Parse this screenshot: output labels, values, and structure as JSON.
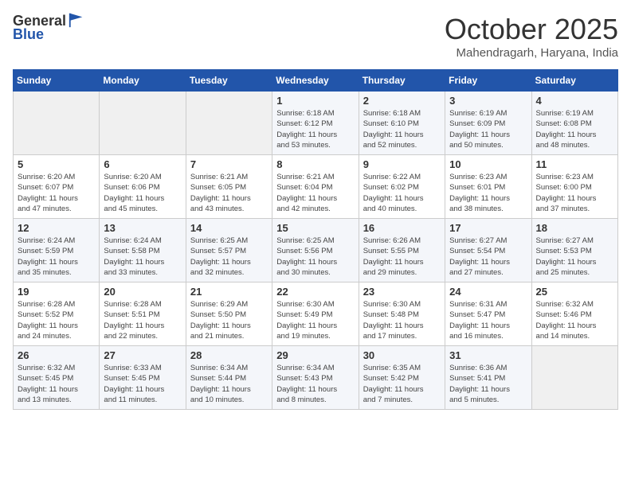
{
  "header": {
    "logo_line1": "General",
    "logo_line2": "Blue",
    "month": "October 2025",
    "location": "Mahendragarh, Haryana, India"
  },
  "weekdays": [
    "Sunday",
    "Monday",
    "Tuesday",
    "Wednesday",
    "Thursday",
    "Friday",
    "Saturday"
  ],
  "weeks": [
    [
      {
        "day": "",
        "info": ""
      },
      {
        "day": "",
        "info": ""
      },
      {
        "day": "",
        "info": ""
      },
      {
        "day": "1",
        "info": "Sunrise: 6:18 AM\nSunset: 6:12 PM\nDaylight: 11 hours\nand 53 minutes."
      },
      {
        "day": "2",
        "info": "Sunrise: 6:18 AM\nSunset: 6:10 PM\nDaylight: 11 hours\nand 52 minutes."
      },
      {
        "day": "3",
        "info": "Sunrise: 6:19 AM\nSunset: 6:09 PM\nDaylight: 11 hours\nand 50 minutes."
      },
      {
        "day": "4",
        "info": "Sunrise: 6:19 AM\nSunset: 6:08 PM\nDaylight: 11 hours\nand 48 minutes."
      }
    ],
    [
      {
        "day": "5",
        "info": "Sunrise: 6:20 AM\nSunset: 6:07 PM\nDaylight: 11 hours\nand 47 minutes."
      },
      {
        "day": "6",
        "info": "Sunrise: 6:20 AM\nSunset: 6:06 PM\nDaylight: 11 hours\nand 45 minutes."
      },
      {
        "day": "7",
        "info": "Sunrise: 6:21 AM\nSunset: 6:05 PM\nDaylight: 11 hours\nand 43 minutes."
      },
      {
        "day": "8",
        "info": "Sunrise: 6:21 AM\nSunset: 6:04 PM\nDaylight: 11 hours\nand 42 minutes."
      },
      {
        "day": "9",
        "info": "Sunrise: 6:22 AM\nSunset: 6:02 PM\nDaylight: 11 hours\nand 40 minutes."
      },
      {
        "day": "10",
        "info": "Sunrise: 6:23 AM\nSunset: 6:01 PM\nDaylight: 11 hours\nand 38 minutes."
      },
      {
        "day": "11",
        "info": "Sunrise: 6:23 AM\nSunset: 6:00 PM\nDaylight: 11 hours\nand 37 minutes."
      }
    ],
    [
      {
        "day": "12",
        "info": "Sunrise: 6:24 AM\nSunset: 5:59 PM\nDaylight: 11 hours\nand 35 minutes."
      },
      {
        "day": "13",
        "info": "Sunrise: 6:24 AM\nSunset: 5:58 PM\nDaylight: 11 hours\nand 33 minutes."
      },
      {
        "day": "14",
        "info": "Sunrise: 6:25 AM\nSunset: 5:57 PM\nDaylight: 11 hours\nand 32 minutes."
      },
      {
        "day": "15",
        "info": "Sunrise: 6:25 AM\nSunset: 5:56 PM\nDaylight: 11 hours\nand 30 minutes."
      },
      {
        "day": "16",
        "info": "Sunrise: 6:26 AM\nSunset: 5:55 PM\nDaylight: 11 hours\nand 29 minutes."
      },
      {
        "day": "17",
        "info": "Sunrise: 6:27 AM\nSunset: 5:54 PM\nDaylight: 11 hours\nand 27 minutes."
      },
      {
        "day": "18",
        "info": "Sunrise: 6:27 AM\nSunset: 5:53 PM\nDaylight: 11 hours\nand 25 minutes."
      }
    ],
    [
      {
        "day": "19",
        "info": "Sunrise: 6:28 AM\nSunset: 5:52 PM\nDaylight: 11 hours\nand 24 minutes."
      },
      {
        "day": "20",
        "info": "Sunrise: 6:28 AM\nSunset: 5:51 PM\nDaylight: 11 hours\nand 22 minutes."
      },
      {
        "day": "21",
        "info": "Sunrise: 6:29 AM\nSunset: 5:50 PM\nDaylight: 11 hours\nand 21 minutes."
      },
      {
        "day": "22",
        "info": "Sunrise: 6:30 AM\nSunset: 5:49 PM\nDaylight: 11 hours\nand 19 minutes."
      },
      {
        "day": "23",
        "info": "Sunrise: 6:30 AM\nSunset: 5:48 PM\nDaylight: 11 hours\nand 17 minutes."
      },
      {
        "day": "24",
        "info": "Sunrise: 6:31 AM\nSunset: 5:47 PM\nDaylight: 11 hours\nand 16 minutes."
      },
      {
        "day": "25",
        "info": "Sunrise: 6:32 AM\nSunset: 5:46 PM\nDaylight: 11 hours\nand 14 minutes."
      }
    ],
    [
      {
        "day": "26",
        "info": "Sunrise: 6:32 AM\nSunset: 5:45 PM\nDaylight: 11 hours\nand 13 minutes."
      },
      {
        "day": "27",
        "info": "Sunrise: 6:33 AM\nSunset: 5:45 PM\nDaylight: 11 hours\nand 11 minutes."
      },
      {
        "day": "28",
        "info": "Sunrise: 6:34 AM\nSunset: 5:44 PM\nDaylight: 11 hours\nand 10 minutes."
      },
      {
        "day": "29",
        "info": "Sunrise: 6:34 AM\nSunset: 5:43 PM\nDaylight: 11 hours\nand 8 minutes."
      },
      {
        "day": "30",
        "info": "Sunrise: 6:35 AM\nSunset: 5:42 PM\nDaylight: 11 hours\nand 7 minutes."
      },
      {
        "day": "31",
        "info": "Sunrise: 6:36 AM\nSunset: 5:41 PM\nDaylight: 11 hours\nand 5 minutes."
      },
      {
        "day": "",
        "info": ""
      }
    ]
  ]
}
